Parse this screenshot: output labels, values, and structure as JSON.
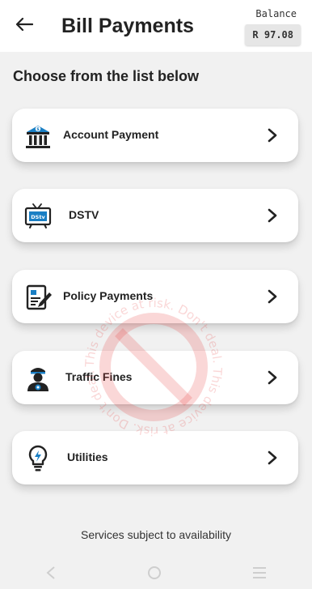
{
  "header": {
    "title": "Bill Payments",
    "back_icon": "arrow-left-icon",
    "balance_label": "Balance",
    "balance_value": "R 97.08"
  },
  "subtitle": "Choose from the list below",
  "options": [
    {
      "label": "Account Payment",
      "icon": "bank-icon"
    },
    {
      "label": "DSTV",
      "icon": "tv-icon",
      "icon_text": "DStv"
    },
    {
      "label": "Policy Payments",
      "icon": "policy-document-icon"
    },
    {
      "label": "Traffic Fines",
      "icon": "traffic-officer-icon"
    },
    {
      "label": "Utilities",
      "icon": "lightbulb-icon"
    }
  ],
  "footer": "Services subject to availability",
  "watermark": {
    "text": "This device at risk. Don't deal. This device at risk. Don't deal. ",
    "color": "#e53935"
  },
  "colors": {
    "accent": "#1a7fc4",
    "background": "#f1f1f1",
    "card": "#ffffff"
  }
}
